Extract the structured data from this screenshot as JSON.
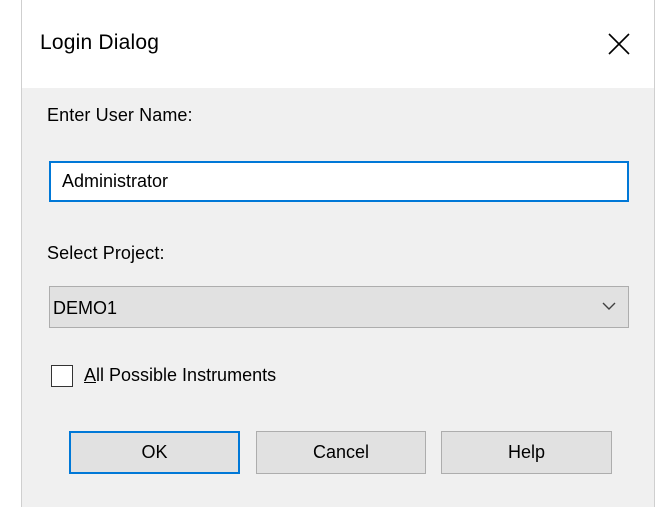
{
  "dialog": {
    "title": "Login Dialog",
    "close_icon": "close-icon"
  },
  "username": {
    "label": "Enter User Name:",
    "value": "Administrator"
  },
  "project": {
    "label": "Select Project:",
    "selected": "DEMO1",
    "arrow_icon": "chevron-down-icon"
  },
  "instruments": {
    "checked": false,
    "label_accel": "A",
    "label_rest": "ll Possible Instruments"
  },
  "buttons": {
    "ok": "OK",
    "cancel": "Cancel",
    "help": "Help"
  },
  "colors": {
    "focus_accent": "#0078d7",
    "client_background": "#f0f0f0",
    "button_background": "#e1e1e1"
  }
}
